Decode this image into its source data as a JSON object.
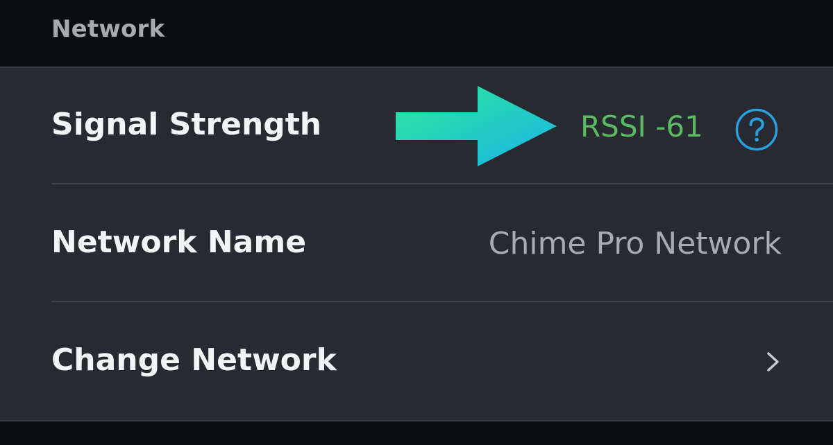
{
  "section": {
    "title": "Network"
  },
  "rows": [
    {
      "label": "Signal Strength",
      "value": "RSSI -61",
      "value_color": "#5cba62",
      "trailing_icon": "help-circle-icon"
    },
    {
      "label": "Network Name",
      "value": "Chime Pro Network"
    },
    {
      "label": "Change Network",
      "trailing_icon": "chevron-right-icon"
    }
  ],
  "annotation": {
    "icon": "arrow-right-icon",
    "gradient": [
      "#2ee89a",
      "#18b6e6"
    ]
  },
  "colors": {
    "background": "#0c0d0f",
    "card": "#272a30",
    "accent_blue": "#2a9fe0",
    "label": "#f3f4f5",
    "secondary_text": "#a8acb1"
  }
}
